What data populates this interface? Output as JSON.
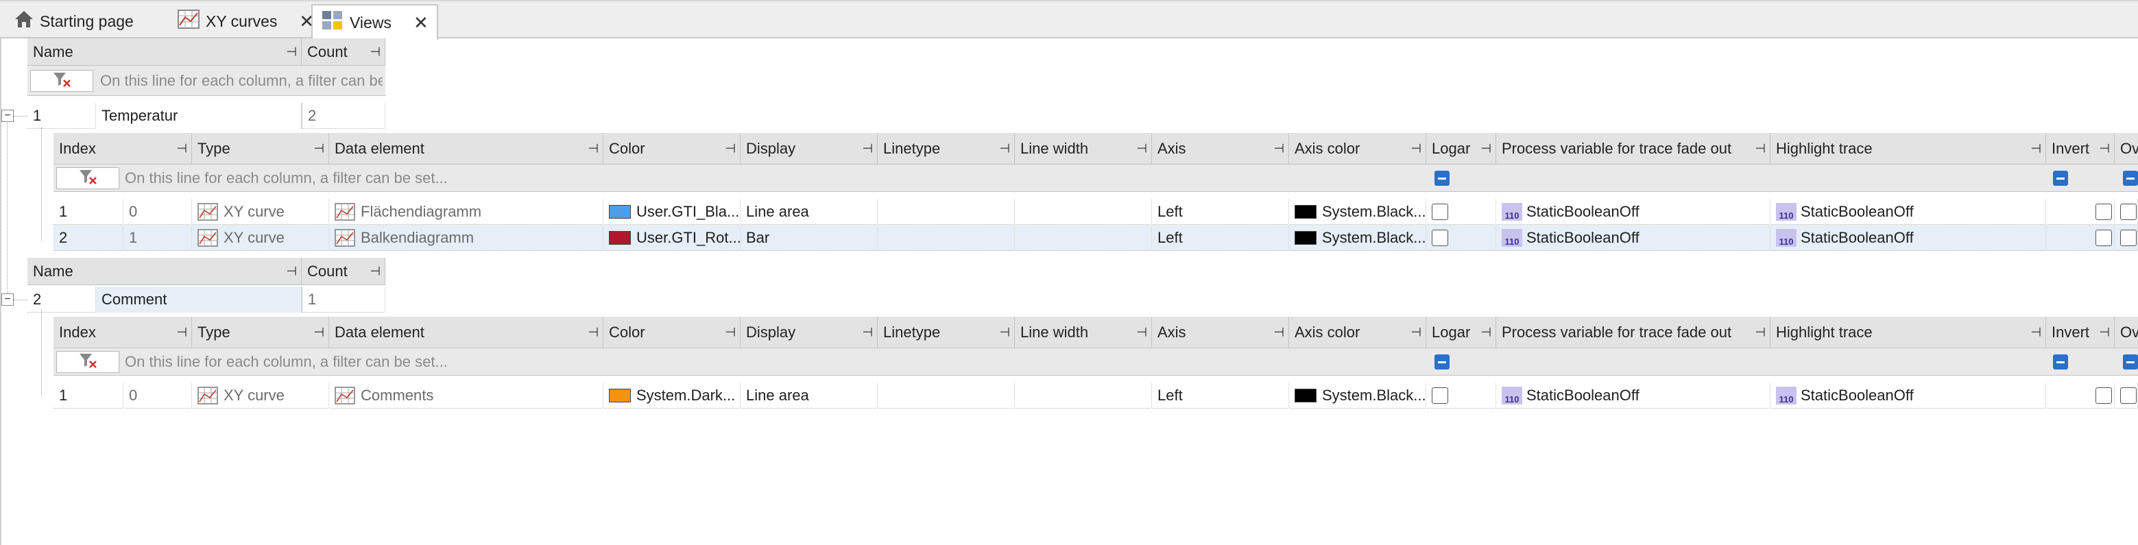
{
  "tabs": [
    {
      "label": "Starting page",
      "icon": "home-icon"
    },
    {
      "label": "XY curves",
      "icon": "xy-chart-icon"
    },
    {
      "label": "Views",
      "icon": "views-icon"
    }
  ],
  "outer_header": {
    "name": "Name",
    "count": "Count",
    "filter_hint": "On this line for each column, a filter can be..."
  },
  "inner_header": {
    "index": "Index",
    "type": "Type",
    "data_element": "Data element",
    "color": "Color",
    "display": "Display",
    "linetype": "Linetype",
    "line_width": "Line width",
    "axis": "Axis",
    "axis_color": "Axis color",
    "logar": "Logar",
    "pv_fade": "Process variable for trace fade out",
    "highlight": "Highlight trace",
    "invert": "Invert",
    "ov": "Ov",
    "filter_hint": "On this line for each column, a filter can be set..."
  },
  "groups": [
    {
      "num": "1",
      "name": "Temperatur",
      "count": "2",
      "rows": [
        {
          "num": "1",
          "index": "0",
          "type": "XY curve",
          "data_element": "Flächendiagramm",
          "color": "User.GTI_Bla...",
          "color_hex": "#4d9ee6",
          "display": "Line area",
          "axis": "Left",
          "axis_color": "System.Black...",
          "pv": "StaticBooleanOff",
          "highlight": "StaticBooleanOff"
        },
        {
          "num": "2",
          "index": "1",
          "type": "XY curve",
          "data_element": "Balkendiagramm",
          "color": "User.GTI_Rot...",
          "color_hex": "#b0172a",
          "display": "Bar",
          "axis": "Left",
          "axis_color": "System.Black...",
          "pv": "StaticBooleanOff",
          "highlight": "StaticBooleanOff"
        }
      ]
    },
    {
      "num": "2",
      "name": "Comment",
      "count": "1",
      "rows": [
        {
          "num": "1",
          "index": "0",
          "type": "XY curve",
          "data_element": "Comments",
          "color": "System.Dark...",
          "color_hex": "#f5920f",
          "display": "Line area",
          "axis": "Left",
          "axis_color": "System.Black...",
          "pv": "StaticBooleanOff",
          "highlight": "StaticBooleanOff"
        }
      ]
    }
  ],
  "pv_icon_text": "110",
  "pin_glyph": "⊣",
  "colors": {
    "header_bg": "#e3e3e3",
    "selected_row": "#e6eef7",
    "accent": "#2a6fc9"
  }
}
